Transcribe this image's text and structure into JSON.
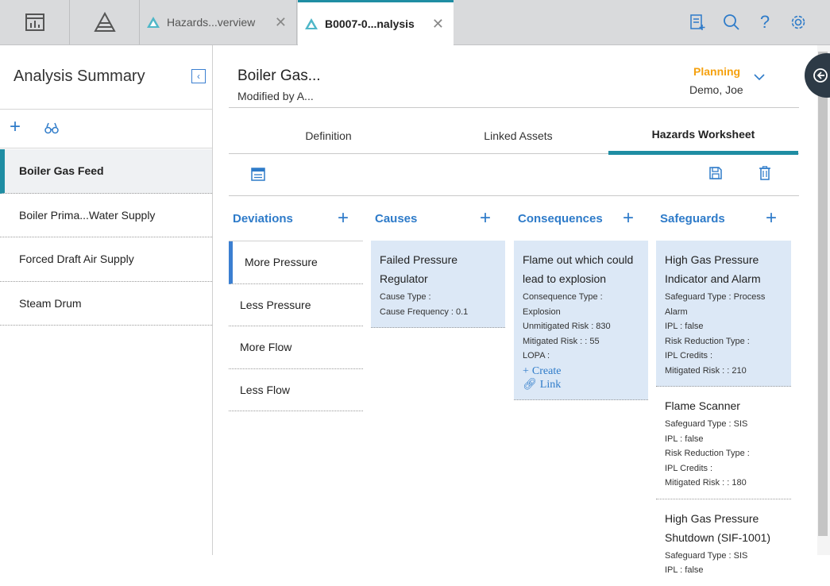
{
  "tabs": [
    {
      "label": "Hazards...verview"
    },
    {
      "label": "B0007-0...nalysis"
    }
  ],
  "sidebar": {
    "title": "Analysis Summary",
    "items": [
      {
        "label": "Boiler Gas Feed"
      },
      {
        "label": "Boiler Prima...Water Supply"
      },
      {
        "label": "Forced Draft Air Supply"
      },
      {
        "label": "Steam Drum"
      }
    ]
  },
  "header": {
    "title": "Boiler Gas...",
    "subtitle": "Modified by A...",
    "state": "Planning",
    "user": "Demo, Joe"
  },
  "worktabs": [
    {
      "label": "Definition"
    },
    {
      "label": "Linked Assets"
    },
    {
      "label": "Hazards Worksheet"
    }
  ],
  "columns": {
    "deviations": {
      "title": "Deviations",
      "items": [
        "More Pressure",
        "Less Pressure",
        "More Flow",
        "Less Flow"
      ]
    },
    "causes": {
      "title": "Causes",
      "card": {
        "title": "Failed Pressure Regulator",
        "lines": [
          "Cause Type :",
          "Cause Frequency : 0.1"
        ]
      }
    },
    "consequences": {
      "title": "Consequences",
      "card": {
        "title": "Flame out which could lead to explosion",
        "lines": [
          "Consequence Type : Explosion",
          "Unmitigated Risk : 830",
          "Mitigated Risk : : 55",
          "LOPA :"
        ],
        "create": "Create",
        "link": "Link"
      }
    },
    "safeguards": {
      "title": "Safeguards",
      "cards": [
        {
          "title": "High Gas Pressure Indicator and Alarm",
          "lines": [
            "Safeguard Type : Process Alarm",
            "IPL : false",
            "Risk Reduction Type :",
            "IPL Credits :",
            "Mitigated Risk : : 210"
          ]
        },
        {
          "title": "Flame Scanner",
          "lines": [
            "Safeguard Type : SIS",
            "IPL : false",
            "Risk Reduction Type :",
            "IPL Credits :",
            "Mitigated Risk : : 180"
          ]
        },
        {
          "title": "High Gas Pressure Shutdown (SIF-1001)",
          "lines": [
            "Safeguard Type : SIS",
            "IPL : false"
          ]
        }
      ]
    }
  },
  "colors": {
    "accent": "#1f8da3",
    "link": "#2e7bc9",
    "state": "#f5a10f",
    "selected": "#dce8f6"
  }
}
